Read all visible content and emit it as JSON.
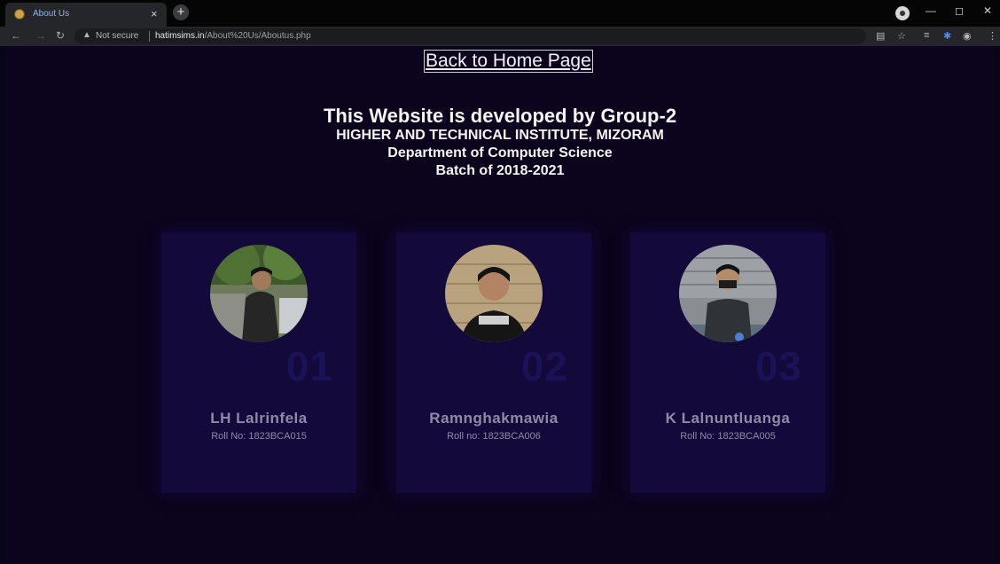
{
  "browser": {
    "tab_title": "About Us",
    "tab_close": "×",
    "new_tab": "+",
    "security_label": "Not secure",
    "url_host": "hatimsims.in",
    "url_path": "/About%20Us/Aboutus.php"
  },
  "page": {
    "home_link": "Back to Home Page",
    "title": "This Website is developed by Group-2",
    "institute": "HIGHER AND TECHNICAL INSTITUTE, MIZORAM",
    "department": "Department of Computer Science",
    "batch": "Batch of 2018-2021"
  },
  "members": [
    {
      "number": "01",
      "name": "LH Lalrinfela",
      "roll": "Roll No: 1823BCA015"
    },
    {
      "number": "02",
      "name": "Ramnghakmawia",
      "roll": "Roll no: 1823BCA006"
    },
    {
      "number": "03",
      "name": "K Lalnuntluanga",
      "roll": "Roll No: 1823BCA005"
    }
  ],
  "colors": {
    "page_background": "#0b041c",
    "card_background": "#130a3b",
    "card_number": "#1a1156",
    "link_text": "#8ab4f8"
  },
  "icons": [
    "back-arrow-icon",
    "forward-arrow-icon",
    "reload-icon",
    "warning-icon",
    "translate-icon",
    "star-icon",
    "extensions-icon",
    "menu-icon",
    "profile-icon",
    "minimize-icon",
    "maximize-icon",
    "close-window-icon"
  ]
}
